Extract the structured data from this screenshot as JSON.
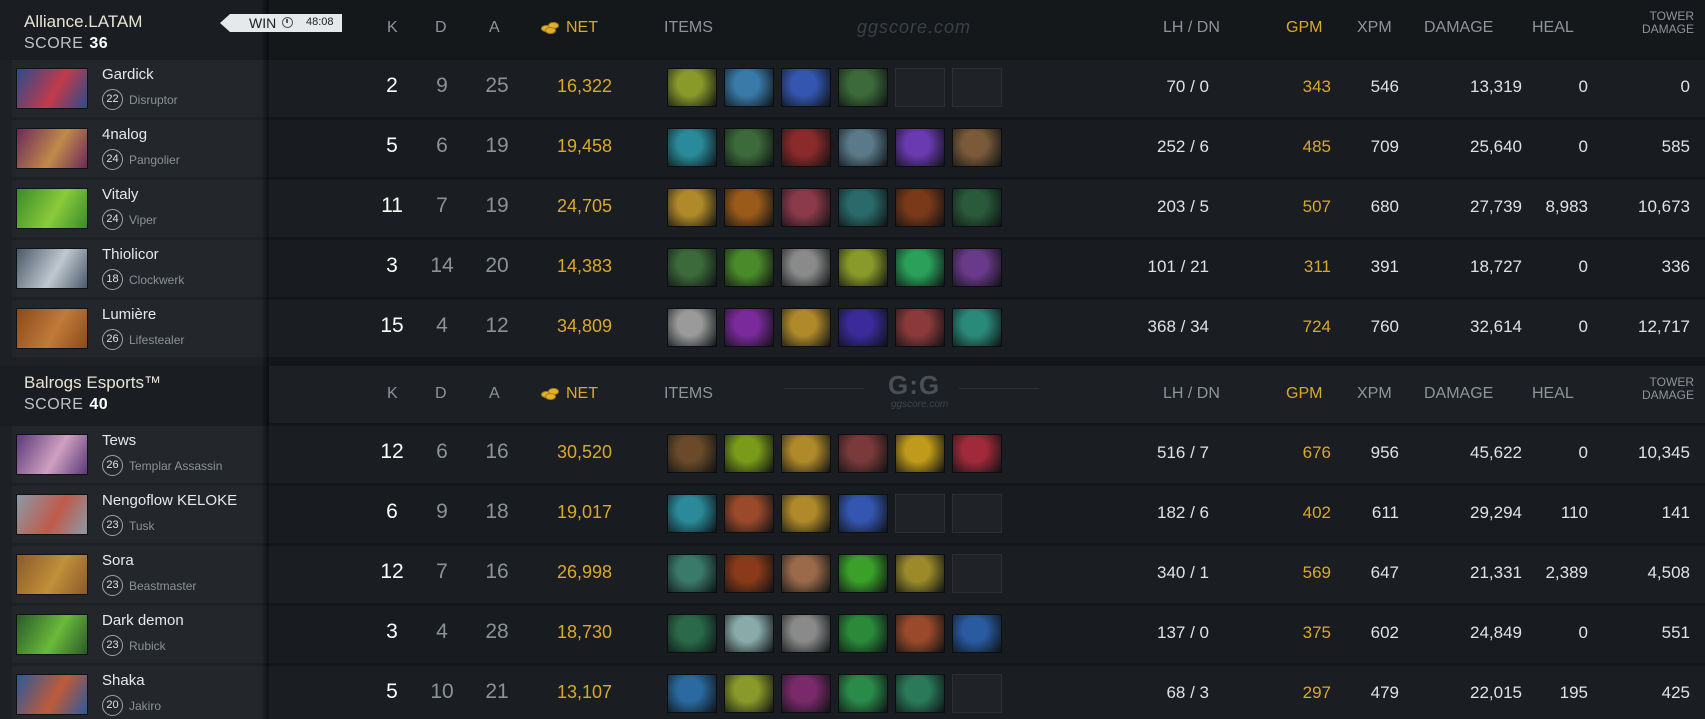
{
  "teams": [
    {
      "name": "Alliance.LATAM",
      "score_label": "SCORE",
      "score": "36",
      "result": "WIN",
      "duration": "48:08",
      "headers": {
        "k": "K",
        "d": "D",
        "a": "A",
        "net": "NET",
        "items": "ITEMS",
        "lh_dn": "LH  /  DN",
        "gpm": "GPM",
        "xpm": "XPM",
        "damage": "DAMAGE",
        "heal": "HEAL",
        "tower_damage_1": "TOWER",
        "tower_damage_2": "DAMAGE"
      },
      "watermark": "ggscore.com",
      "players": [
        {
          "name": "Gardick",
          "level": "22",
          "hero": "Disruptor",
          "portrait_colors": [
            "#2b4b8c",
            "#c23a4a"
          ],
          "k": "2",
          "d": "9",
          "a": "25",
          "net": "16,322",
          "lh_dn": "70  /  0",
          "gpm": "343",
          "xpm": "546",
          "damage": "13,319",
          "heal": "0",
          "tower": "0",
          "items": [
            "#8a9a2a",
            "#3a7aa8",
            "#3456b0",
            "#3c6a3a",
            "",
            ""
          ]
        },
        {
          "name": "4nalog",
          "level": "24",
          "hero": "Pangolier",
          "portrait_colors": [
            "#6a2a5a",
            "#c08a4a"
          ],
          "k": "5",
          "d": "6",
          "a": "19",
          "net": "19,458",
          "lh_dn": "252  /  6",
          "gpm": "485",
          "xpm": "709",
          "damage": "25,640",
          "heal": "0",
          "tower": "585",
          "items": [
            "#2a8a9a",
            "#3c6a3a",
            "#8a2a2a",
            "#5a7a8a",
            "#6a3ab0",
            "#7a5a3a"
          ]
        },
        {
          "name": "Vitaly",
          "level": "24",
          "hero": "Viper",
          "portrait_colors": [
            "#3a8a2a",
            "#8acb3a"
          ],
          "k": "11",
          "d": "7",
          "a": "19",
          "net": "24,705",
          "lh_dn": "203  /  5",
          "gpm": "507",
          "xpm": "680",
          "damage": "27,739",
          "heal": "8,983",
          "tower": "10,673",
          "items": [
            "#b08a2a",
            "#9a5a1a",
            "#8a3a4a",
            "#2a6a6a",
            "#7a3a1a",
            "#2a5a3a"
          ]
        },
        {
          "name": "Thiolicor",
          "level": "18",
          "hero": "Clockwerk",
          "portrait_colors": [
            "#4a5a6a",
            "#c0c8d0"
          ],
          "k": "3",
          "d": "14",
          "a": "20",
          "net": "14,383",
          "lh_dn": "101  /  21",
          "gpm": "311",
          "xpm": "391",
          "damage": "18,727",
          "heal": "0",
          "tower": "336",
          "items": [
            "#3c6a3a",
            "#4a8a2a",
            "#8a8a8a",
            "#8a9a2a",
            "#2aa05a",
            "#6a3a8a"
          ]
        },
        {
          "name": "Lumière",
          "level": "26",
          "hero": "Lifestealer",
          "portrait_colors": [
            "#8a4a1a",
            "#c07a3a"
          ],
          "k": "15",
          "d": "4",
          "a": "12",
          "net": "34,809",
          "lh_dn": "368  /  34",
          "gpm": "724",
          "xpm": "760",
          "damage": "32,614",
          "heal": "0",
          "tower": "12,717",
          "items": [
            "#9a9a9a",
            "#7a2a9a",
            "#b08a2a",
            "#3a2a9a",
            "#8a3a3a",
            "#2a8a7a"
          ]
        }
      ]
    },
    {
      "name": "Balrogs  Esports™",
      "score_label": "SCORE",
      "score": "40",
      "headers": {
        "k": "K",
        "d": "D",
        "a": "A",
        "net": "NET",
        "items": "ITEMS",
        "lh_dn": "LH  /  DN",
        "gpm": "GPM",
        "xpm": "XPM",
        "damage": "DAMAGE",
        "heal": "HEAL",
        "tower_damage_1": "TOWER",
        "tower_damage_2": "DAMAGE"
      },
      "watermark_logo": "G:G",
      "watermark_sub": "ggscore.com",
      "players": [
        {
          "name": "Tews",
          "level": "26",
          "hero": "Templar Assassin",
          "portrait_colors": [
            "#5a3a7a",
            "#d0a0c0"
          ],
          "k": "12",
          "d": "6",
          "a": "16",
          "net": "30,520",
          "lh_dn": "516  /  7",
          "gpm": "676",
          "xpm": "956",
          "damage": "45,622",
          "heal": "0",
          "tower": "10,345",
          "items": [
            "#6a4a2a",
            "#7a9a1a",
            "#b08a2a",
            "#7a3a3a",
            "#c09a1a",
            "#a02a3a"
          ]
        },
        {
          "name": "Nengoflow KELOKE",
          "level": "23",
          "hero": "Tusk",
          "portrait_colors": [
            "#8a9aa8",
            "#c05a4a"
          ],
          "k": "6",
          "d": "9",
          "a": "18",
          "net": "19,017",
          "lh_dn": "182  /  6",
          "gpm": "402",
          "xpm": "611",
          "damage": "29,294",
          "heal": "110",
          "tower": "141",
          "items": [
            "#2a8a9a",
            "#9a4a2a",
            "#b08a2a",
            "#3456b0",
            "",
            ""
          ]
        },
        {
          "name": "Sora",
          "level": "23",
          "hero": "Beastmaster",
          "portrait_colors": [
            "#8a5a2a",
            "#c0903a"
          ],
          "k": "12",
          "d": "7",
          "a": "16",
          "net": "26,998",
          "lh_dn": "340  /  1",
          "gpm": "569",
          "xpm": "647",
          "damage": "21,331",
          "heal": "2,389",
          "tower": "4,508",
          "items": [
            "#3a7a6a",
            "#8a3a1a",
            "#9a6a4a",
            "#3aa02a",
            "#9a8a2a",
            ""
          ]
        },
        {
          "name": "Dark demon",
          "level": "23",
          "hero": "Rubick",
          "portrait_colors": [
            "#2a5a2a",
            "#6aba3a"
          ],
          "k": "3",
          "d": "4",
          "a": "28",
          "net": "18,730",
          "lh_dn": "137  /  0",
          "gpm": "375",
          "xpm": "602",
          "damage": "24,849",
          "heal": "0",
          "tower": "551",
          "items": [
            "#2a6a4a",
            "#8aaaaa",
            "#8a8a8a",
            "#2a8a3a",
            "#9a4a2a",
            "#2a5aa0"
          ]
        },
        {
          "name": "Shaka",
          "level": "20",
          "hero": "Jakiro",
          "portrait_colors": [
            "#2a5a9a",
            "#c05a3a"
          ],
          "k": "5",
          "d": "10",
          "a": "21",
          "net": "13,107",
          "lh_dn": "68  /  3",
          "gpm": "297",
          "xpm": "479",
          "damage": "22,015",
          "heal": "195",
          "tower": "425",
          "items": [
            "#2a6aa0",
            "#8a9a2a",
            "#7a2a6a",
            "#2a8a4a",
            "#2a7a5a",
            ""
          ]
        }
      ]
    }
  ]
}
